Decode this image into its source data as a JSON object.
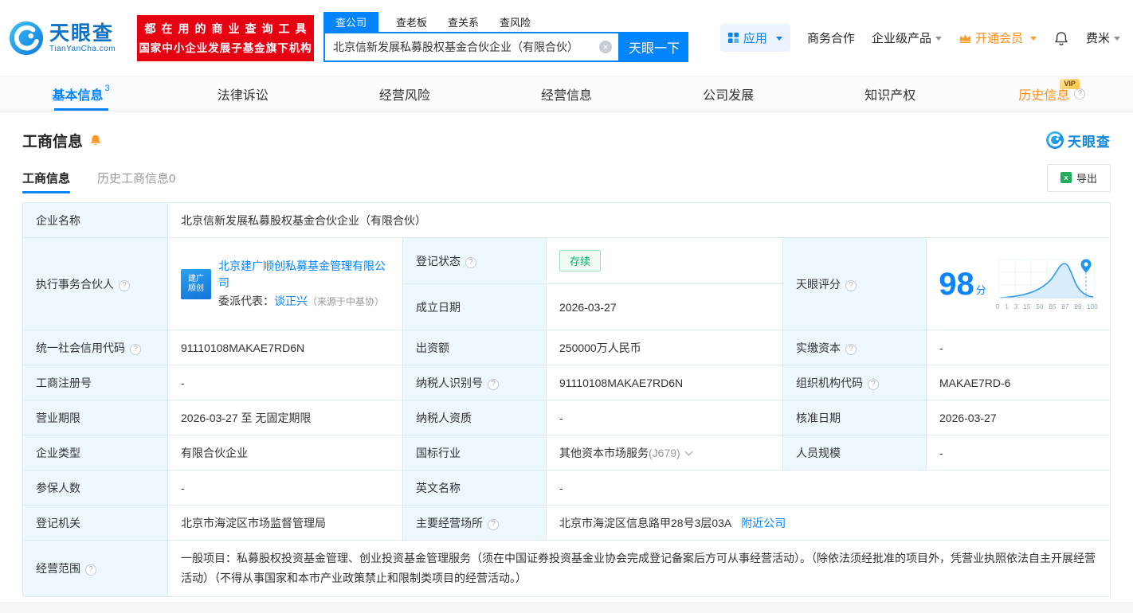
{
  "brand": {
    "name": "天眼查",
    "domain": "TianYanCha.com"
  },
  "header": {
    "promo_line1": "都在用的商业查询工具",
    "promo_line2": "国家中小企业发展子基金旗下机构",
    "search_tabs": [
      "查公司",
      "查老板",
      "查关系",
      "查风险"
    ],
    "search_value": "北京信新发展私募股权基金合伙企业（有限合伙）",
    "search_button": "天眼一下",
    "menu": {
      "apps": "应用",
      "cooperation": "商务合作",
      "enterprise_products": "企业级产品",
      "vip": "开通会员",
      "fermi": "费米"
    }
  },
  "nav_tabs": [
    {
      "label": "基本信息",
      "count": "3"
    },
    {
      "label": "法律诉讼"
    },
    {
      "label": "经营风险"
    },
    {
      "label": "经营信息"
    },
    {
      "label": "公司发展"
    },
    {
      "label": "知识产权"
    },
    {
      "label": "历史信息",
      "badge": "VIP"
    }
  ],
  "section": {
    "title": "工商信息",
    "subtabs": [
      "工商信息",
      "历史工商信息0"
    ],
    "export": "导出",
    "logo_text": "天眼查"
  },
  "company": {
    "name_label": "企业名称",
    "name": "北京信新发展私募股权基金合伙企业（有限合伙）",
    "partner_label": "执行事务合伙人",
    "partner": {
      "logo_line1": "建广",
      "logo_line2": "顺创",
      "company": "北京建广顺创私募基金管理有限公司",
      "rep_label": "委派代表：",
      "rep_name": "谈正兴",
      "rep_source": "（来源于中基协）"
    },
    "score": {
      "label": "天眼评分",
      "value": "98",
      "unit": "分",
      "ticks": [
        "0",
        "1",
        "3",
        "15",
        "50",
        "85",
        "97",
        "99",
        "100"
      ]
    },
    "fields": {
      "reg_status": {
        "label": "登记状态",
        "value": "存续"
      },
      "establish_date": {
        "label": "成立日期",
        "value": "2026-03-27"
      },
      "credit_code": {
        "label": "统一社会信用代码",
        "value": "91110108MAKAE7RD6N"
      },
      "capital": {
        "label": "出资额",
        "value": "250000万人民币"
      },
      "paid_in_capital": {
        "label": "实缴资本",
        "value": "-"
      },
      "reg_no": {
        "label": "工商注册号",
        "value": "-"
      },
      "taxpayer_no": {
        "label": "纳税人识别号",
        "value": "91110108MAKAE7RD6N"
      },
      "org_code": {
        "label": "组织机构代码",
        "value": "MAKAE7RD-6"
      },
      "business_term": {
        "label": "营业期限",
        "value": "2026-03-27 至 无固定期限"
      },
      "taxpayer_quality": {
        "label": "纳税人资质",
        "value": "-"
      },
      "approved_date": {
        "label": "核准日期",
        "value": "2026-03-27"
      },
      "enterprise_type": {
        "label": "企业类型",
        "value": "有限合伙企业"
      },
      "industry": {
        "label": "国标行业",
        "value": "其他资本市场服务",
        "code": "(J679)"
      },
      "staff_size": {
        "label": "人员规模",
        "value": "-"
      },
      "insured_num": {
        "label": "参保人数",
        "value": "-"
      },
      "english_name": {
        "label": "英文名称",
        "value": "-"
      },
      "reg_authority": {
        "label": "登记机关",
        "value": "北京市海淀区市场监督管理局"
      },
      "business_site": {
        "label": "主要经营场所",
        "value": "北京市海淀区信息路甲28号3层03A",
        "link": "附近公司"
      },
      "business_scope": {
        "label": "经营范围",
        "value": "一般项目：私募股权投资基金管理、创业投资基金管理服务（须在中国证券投资基金业协会完成登记备案后方可从事经营活动）。（除依法须经批准的项目外，凭营业执照依法自主开展经营活动）（不得从事国家和本市产业政策禁止和限制类项目的经营活动。）"
      }
    }
  }
}
